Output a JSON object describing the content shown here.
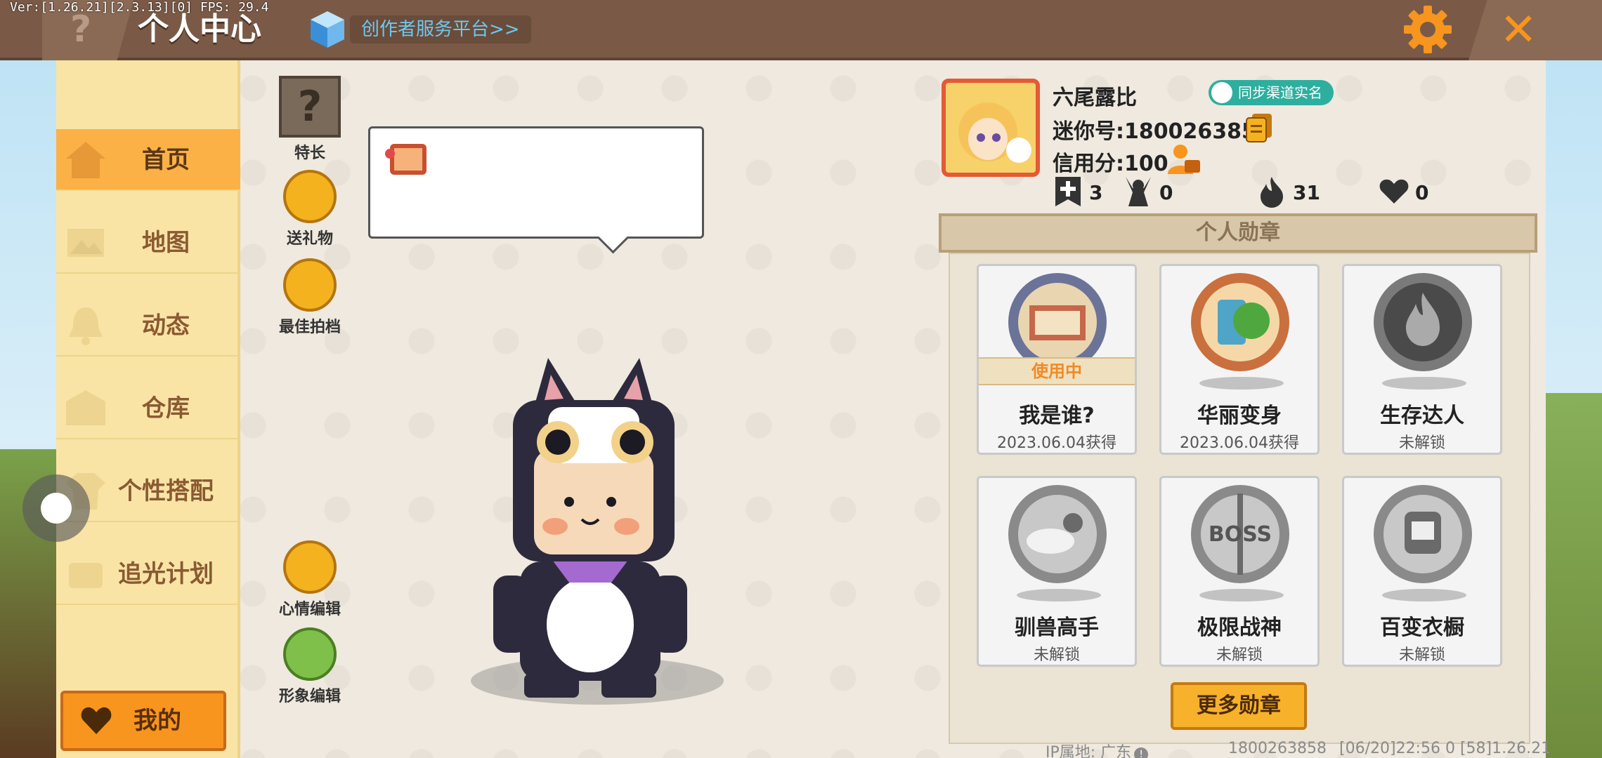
{
  "debug": {
    "text": "Ver:[1.26.21][2.3.13][0] FPS: 29.4"
  },
  "header": {
    "help_icon": "?",
    "title": "个人中心",
    "creator_link": "创作者服务平台>>",
    "close_icon": "✕"
  },
  "sidebar": {
    "items": [
      {
        "label": "首页",
        "icon": "home-icon",
        "active": true
      },
      {
        "label": "地图",
        "icon": "map-icon"
      },
      {
        "label": "动态",
        "icon": "bell-icon"
      },
      {
        "label": "仓库",
        "icon": "warehouse-icon"
      },
      {
        "label": "个性搭配",
        "icon": "outfit-icon"
      },
      {
        "label": "追光计划",
        "icon": "spotlight-icon"
      }
    ],
    "my_button": "我的"
  },
  "actions": {
    "talent": {
      "icon": "?",
      "label": "特长"
    },
    "gift": {
      "label": "送礼物"
    },
    "partner": {
      "label": "最佳拍档"
    },
    "mood": {
      "label": "心情编辑"
    },
    "avatar_edit": {
      "label": "形象编辑"
    }
  },
  "profile": {
    "nickname": "六尾露比",
    "realname_badge": "同步渠道实名",
    "mini_id": "迷你号:1800263858",
    "credit": "信用分:100",
    "stats": {
      "add": "3",
      "fans": "0",
      "heat": "31",
      "likes": "0"
    }
  },
  "badges": {
    "header": "个人勋章",
    "in_use_label": "使用中",
    "items": [
      {
        "name": "我是谁?",
        "sub": "2023.06.04获得",
        "in_use": true,
        "color": "#8a8fb0"
      },
      {
        "name": "华丽变身",
        "sub": "2023.06.04获得",
        "in_use": false,
        "color": "#e88a5a"
      },
      {
        "name": "生存达人",
        "sub": "未解锁",
        "in_use": false,
        "color": "#8f8f8f"
      },
      {
        "name": "驯兽高手",
        "sub": "未解锁",
        "in_use": false,
        "color": "#9a9a9a"
      },
      {
        "name": "极限战神",
        "sub": "未解锁",
        "in_use": false,
        "color": "#9a9a9a"
      },
      {
        "name": "百变衣橱",
        "sub": "未解锁",
        "in_use": false,
        "color": "#9a9a9a"
      }
    ],
    "more_button": "更多勋章"
  },
  "footer": {
    "ip": "IP属地: 广东",
    "info_icon": "!",
    "user_id": "1800263858",
    "version": "[06/20]22:56 0   [58]1.26.21"
  },
  "colors": {
    "accent": "#f7951e",
    "topbar": "#7a5a46",
    "sidebar": "#f9e4a6",
    "active_tab": "#fbb146"
  }
}
